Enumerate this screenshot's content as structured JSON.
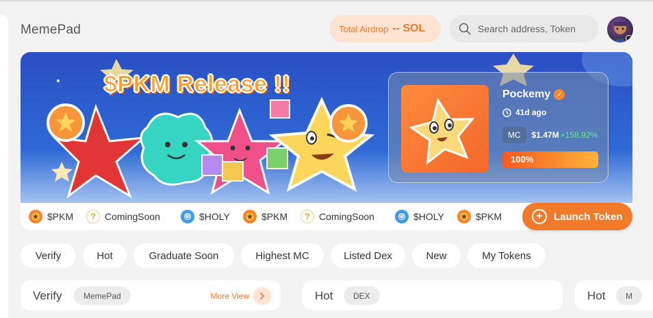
{
  "header": {
    "brand": "MemePad",
    "airdrop_label": "Total Airdrop",
    "airdrop_value": "-- SOL",
    "search_placeholder": "Search address, Token"
  },
  "banner": {
    "title": "$PKM Release !!",
    "featured": {
      "name": "Pockemy",
      "age": "41d ago",
      "mc_label": "MC",
      "mc_value": "$1.47M",
      "mc_change": "+158.92%",
      "progress_label": "100%",
      "progress": 1.0
    }
  },
  "ticker": [
    {
      "icon": "pkm",
      "label": "$PKM"
    },
    {
      "icon": "coming",
      "label": "ComingSoon"
    },
    {
      "icon": "holy",
      "label": "$HOLY"
    },
    {
      "icon": "pkm",
      "label": "$PKM"
    },
    {
      "icon": "coming",
      "label": "ComingSoon"
    },
    {
      "icon": "holy",
      "label": "$HOLY"
    },
    {
      "icon": "pkm",
      "label": "$PKM"
    }
  ],
  "launch_label": "Launch Token",
  "filters": [
    "Verify",
    "Hot",
    "Graduate Soon",
    "Highest MC",
    "Listed Dex",
    "New",
    "My Tokens"
  ],
  "panels": [
    {
      "title": "Verify",
      "tag": "MemePad",
      "more": "More View"
    },
    {
      "title": "Hot",
      "tag": "DEX"
    },
    {
      "title": "Hot",
      "tag": "M"
    }
  ],
  "colors": {
    "accent": "#f27a2b",
    "banner_blue": "#2f69d6",
    "positive": "#5ef08a"
  }
}
